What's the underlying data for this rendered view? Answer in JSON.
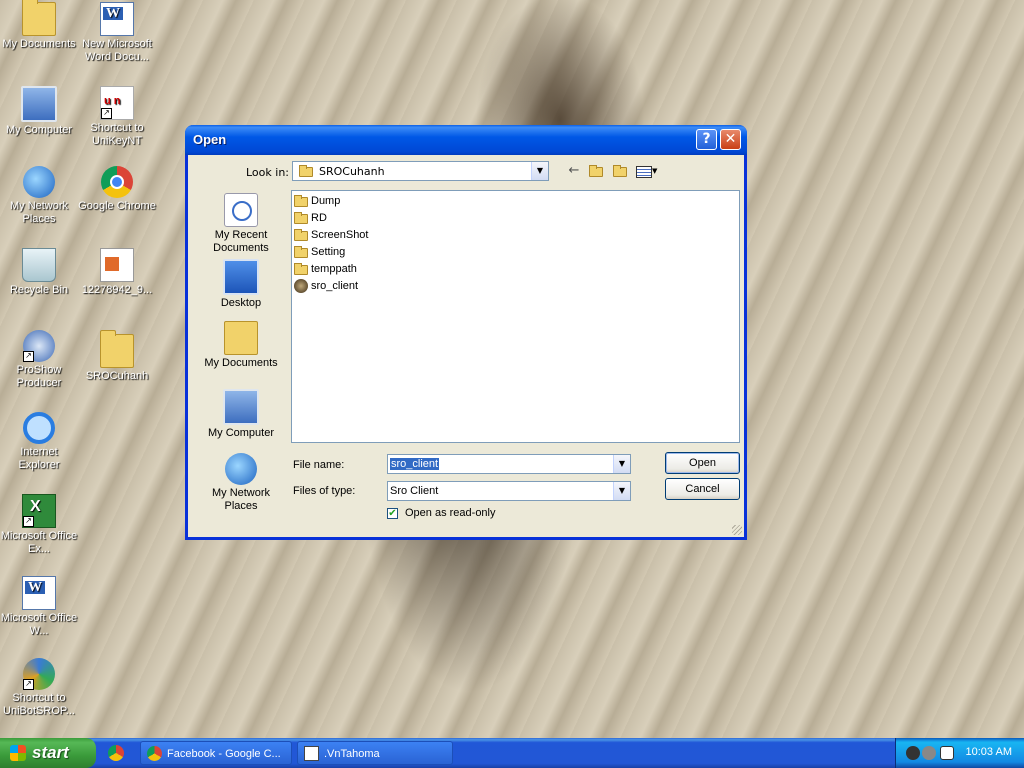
{
  "desktop": {
    "icons": [
      {
        "label": "My Documents"
      },
      {
        "label": "New Microsoft Word Docu..."
      },
      {
        "label": "My Computer"
      },
      {
        "label": "Shortcut to UniKeyNT"
      },
      {
        "label": "My Network Places"
      },
      {
        "label": "Google Chrome"
      },
      {
        "label": "Recycle Bin"
      },
      {
        "label": "12278942_9..."
      },
      {
        "label": "ProShow Producer"
      },
      {
        "label": "SROCuhanh"
      },
      {
        "label": "Internet Explorer"
      },
      {
        "label": "Microsoft Office Ex..."
      },
      {
        "label": "Microsoft Office W..."
      },
      {
        "label": "Shortcut to UniBotSROP..."
      }
    ]
  },
  "dialog": {
    "title": "Open",
    "help_glyph": "?",
    "close_glyph": "✕",
    "look_in_label": "Look in:",
    "look_in_value": "SROCuhanh",
    "places": [
      {
        "label": "My Recent Documents"
      },
      {
        "label": "Desktop"
      },
      {
        "label": "My Documents"
      },
      {
        "label": "My Computer"
      },
      {
        "label": "My Network Places"
      }
    ],
    "files": [
      {
        "name": "Dump",
        "type": "folder"
      },
      {
        "name": "RD",
        "type": "folder"
      },
      {
        "name": "ScreenShot",
        "type": "folder"
      },
      {
        "name": "Setting",
        "type": "folder"
      },
      {
        "name": "temppath",
        "type": "folder"
      },
      {
        "name": "sro_client",
        "type": "application"
      }
    ],
    "file_name_label": "File name:",
    "file_name_value": "sro_client",
    "files_of_type_label": "Files of type:",
    "files_of_type_value": "Sro Client",
    "read_only_label": "Open as read-only",
    "read_only_checked": true,
    "open_button": "Open",
    "cancel_button": "Cancel"
  },
  "taskbar": {
    "start_label": "start",
    "tasks": [
      {
        "label": "Facebook - Google C..."
      },
      {
        "label": ".VnTahoma"
      }
    ],
    "clock": "10:03 AM"
  }
}
